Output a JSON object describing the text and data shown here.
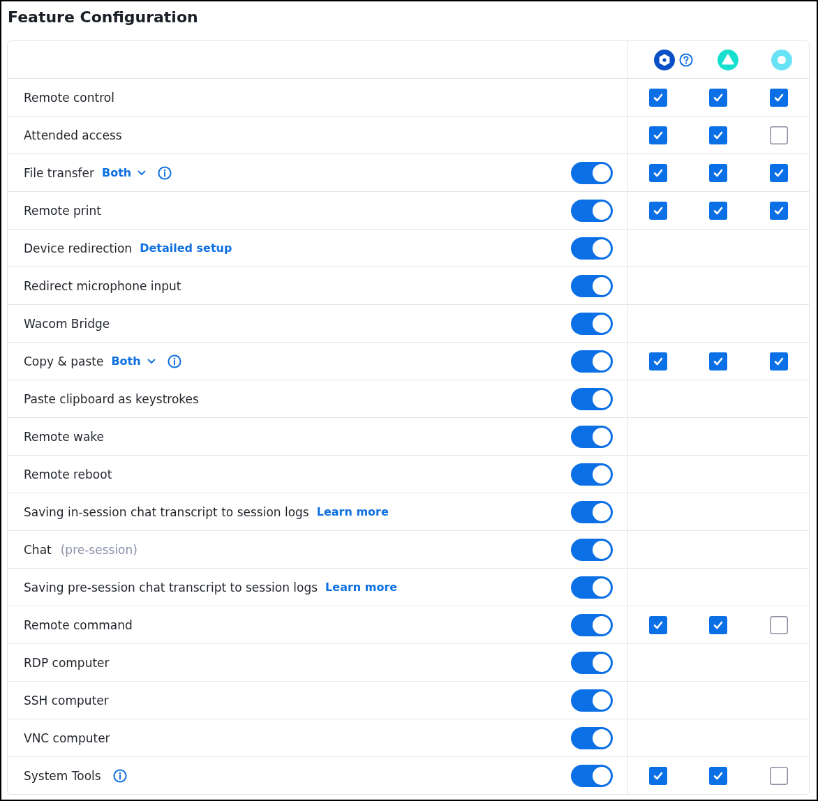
{
  "title": "Feature Configuration",
  "columns": [
    {
      "kind": "hexagon",
      "color": "#0b4fc6",
      "help": true
    },
    {
      "kind": "triangle",
      "color": "#17dfcf"
    },
    {
      "kind": "ring",
      "color": "#68e3f6"
    }
  ],
  "rows": [
    {
      "label": "Remote control",
      "checks": [
        {
          "checked": true
        },
        {
          "checked": true
        },
        {
          "checked": true
        }
      ]
    },
    {
      "label": "Attended access",
      "checks": [
        {
          "checked": true
        },
        {
          "checked": true
        },
        {
          "checked": false
        }
      ]
    },
    {
      "label": "File transfer",
      "dropdown": "Both",
      "info": true,
      "on": true,
      "checks": [
        {
          "checked": true
        },
        {
          "checked": true
        },
        {
          "checked": true
        }
      ]
    },
    {
      "label": "Remote print",
      "on": true,
      "checks": [
        {
          "checked": true
        },
        {
          "checked": true
        },
        {
          "checked": true
        }
      ]
    },
    {
      "label": "Device redirection",
      "setup_link": "Detailed setup",
      "on": true
    },
    {
      "label": "Redirect microphone input",
      "on": true
    },
    {
      "label": "Wacom Bridge",
      "on": true
    },
    {
      "label": "Copy & paste",
      "dropdown": "Both",
      "info": true,
      "on": true,
      "checks": [
        {
          "checked": true
        },
        {
          "checked": true
        },
        {
          "checked": true
        }
      ]
    },
    {
      "label": "Paste clipboard as keystrokes",
      "on": true
    },
    {
      "label": "Remote wake",
      "on": true
    },
    {
      "label": "Remote reboot",
      "on": true
    },
    {
      "label": "Saving in-session chat transcript to session logs",
      "link": "Learn more",
      "on": true
    },
    {
      "label": "Chat",
      "note": "(pre-session)",
      "on": true
    },
    {
      "label": "Saving pre-session chat transcript to session logs",
      "link": "Learn more",
      "on": true
    },
    {
      "label": "Remote command",
      "on": true,
      "checks": [
        {
          "checked": true
        },
        {
          "checked": true
        },
        {
          "checked": false
        }
      ]
    },
    {
      "label": "RDP computer",
      "on": true
    },
    {
      "label": "SSH computer",
      "on": true
    },
    {
      "label": "VNC computer",
      "on": true
    },
    {
      "label": "System Tools",
      "info": true,
      "on": true,
      "checks": [
        {
          "checked": true
        },
        {
          "checked": true
        },
        {
          "checked": false
        }
      ]
    }
  ]
}
